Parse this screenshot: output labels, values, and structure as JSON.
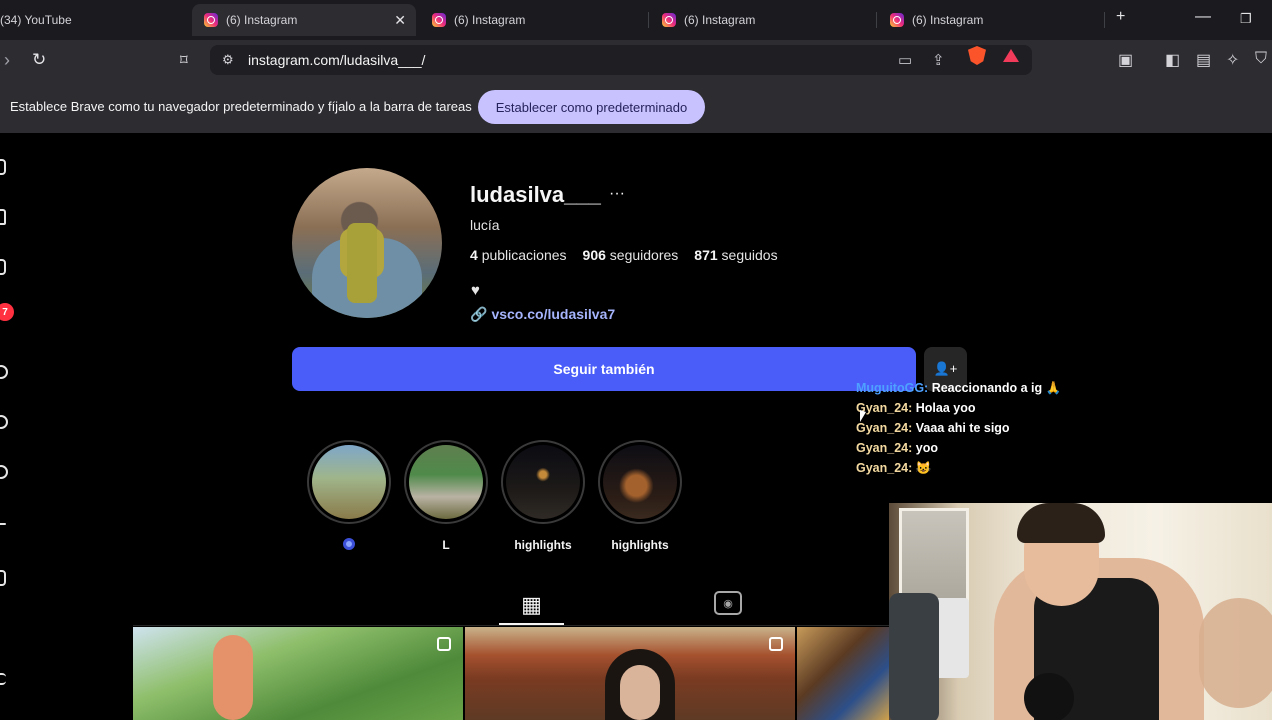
{
  "browser": {
    "tabs": [
      {
        "title": "(34) YouTube"
      },
      {
        "title": "(6) Instagram"
      },
      {
        "title": "(6) Instagram"
      },
      {
        "title": "(6) Instagram"
      },
      {
        "title": "(6) Instagram"
      }
    ],
    "new_tab": "+",
    "url": "instagram.com/ludasilva___/",
    "infobar": {
      "text": "Establece Brave como tu navegador predeterminado y fíjalo a la barra de tareas",
      "button": "Establecer como predeterminado"
    }
  },
  "sidebar": {
    "notification_count": "7"
  },
  "profile": {
    "username": "ludasilva___",
    "more": "···",
    "full_name": "lucía",
    "stats": {
      "posts_count": "4",
      "posts_label": "publicaciones",
      "followers_count": "906",
      "followers_label": "seguidores",
      "following_count": "871",
      "following_label": "seguidos"
    },
    "bio_emoji": "♥",
    "link": "vsco.co/ludasilva7",
    "follow_button": "Seguir también"
  },
  "highlights": [
    {
      "label": ""
    },
    {
      "label": "L"
    },
    {
      "label": "highlights"
    },
    {
      "label": "highlights"
    }
  ],
  "chat": [
    {
      "user": "MuguitoGG:",
      "msg": "Reaccionando a ig 🙏"
    },
    {
      "user": "Gyan_24:",
      "msg": "Holaa yoo"
    },
    {
      "user": "Gyan_24:",
      "msg": "Vaaa ahi te sigo"
    },
    {
      "user": "Gyan_24:",
      "msg": "yoo"
    },
    {
      "user": "Gyan_24:",
      "msg": "😺"
    }
  ],
  "colors": {
    "follow_button": "#4a5df9",
    "link": "#a5b4fc",
    "infobar_button": "#c8c2ff",
    "chat_username": "#f3d9a0"
  }
}
